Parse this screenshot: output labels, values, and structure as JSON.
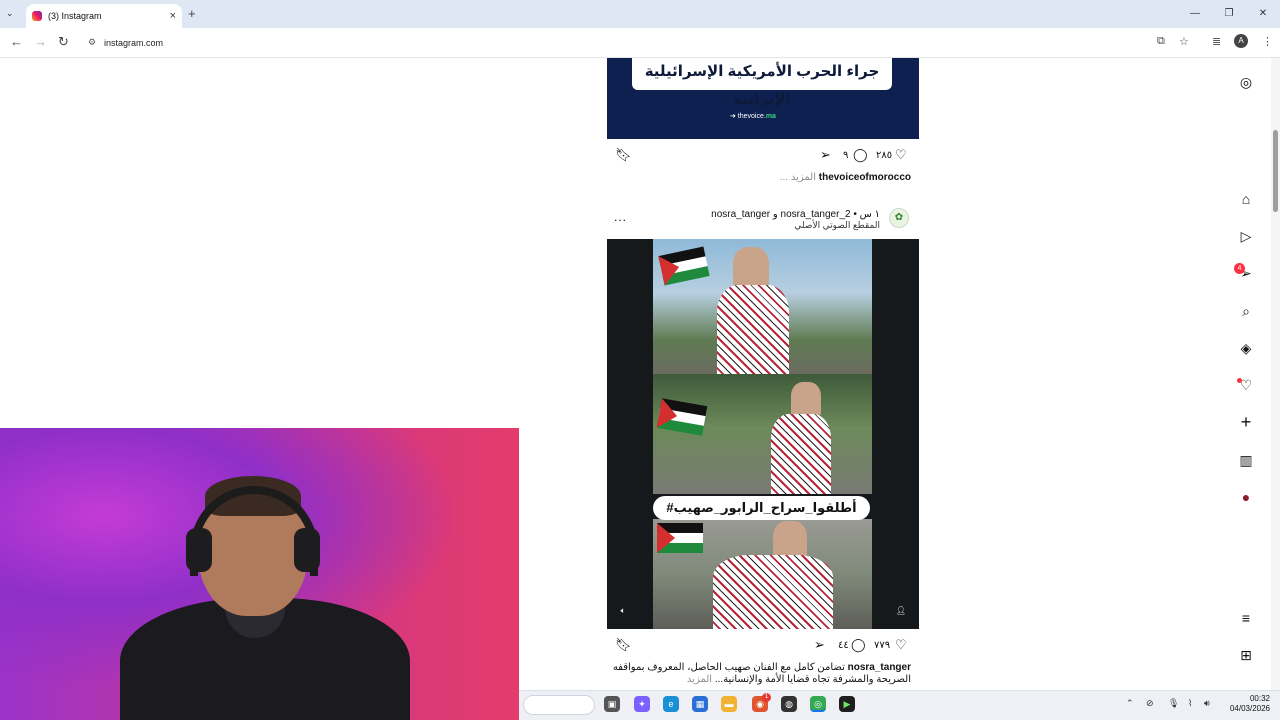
{
  "browser": {
    "tab_title": "(3) Instagram",
    "tab_close": "×",
    "new_tab": "+",
    "url": "instagram.com",
    "profile_initial": "A",
    "back": "←",
    "forward": "→",
    "reload": "↻",
    "window_controls": [
      "—",
      "❐",
      "✕"
    ]
  },
  "right_nav": {
    "items": [
      {
        "name": "instagram-logo-icon",
        "glyph": "◎"
      },
      {
        "name": "home-icon",
        "glyph": "⌂"
      },
      {
        "name": "reels-icon",
        "glyph": "▷"
      },
      {
        "name": "messages-icon",
        "glyph": "➢"
      },
      {
        "name": "search-icon",
        "glyph": "⌕"
      },
      {
        "name": "explore-icon",
        "glyph": "◈"
      },
      {
        "name": "notifications-heart-icon",
        "glyph": "♡"
      },
      {
        "name": "create-icon",
        "glyph": "+"
      },
      {
        "name": "dashboard-icon",
        "glyph": "▥"
      },
      {
        "name": "profile-avatar-icon",
        "glyph": "●"
      },
      {
        "name": "more-menu-icon",
        "glyph": "≡"
      },
      {
        "name": "also-from-meta-icon",
        "glyph": "⊞"
      }
    ],
    "messages_badge": "4"
  },
  "post1": {
    "banner_text": "جراء الحرب الأمريكية الإسرائيلية الإيرانية",
    "brand_prefix": "➔ thevoice",
    "brand_suffix": ".ma",
    "likes": "٢٨٥",
    "comments": "٩",
    "author": "thevoiceofmorocco",
    "more_text": "... المزيد"
  },
  "post2": {
    "users": "nosra_tanger و nosra_tanger_2 • ١ س",
    "audio": "المقطع الصوتي الأصلي",
    "more_options": "...",
    "hashtag": "#أطلقوا_سراح_الرابور_صهيب",
    "likes": "٧٧٩",
    "comments": "٤٤",
    "author": "nosra_tanger",
    "caption_line1": "تضامن كامل مع الفنان صهيب الحاصل، المعروف بمواقفه",
    "caption_line2": "الصريحة والمشرفة تجاه قضايا الأمة والإنسانية...",
    "more_text": "المزيد"
  },
  "taskbar": {
    "time": "00:32",
    "date": "04/03/2026",
    "notification_badge": "1"
  },
  "colors": {
    "accent_badge": "#ff3040",
    "post1_bg": "#0d2050",
    "webcam_bg": "#c43bd6"
  }
}
